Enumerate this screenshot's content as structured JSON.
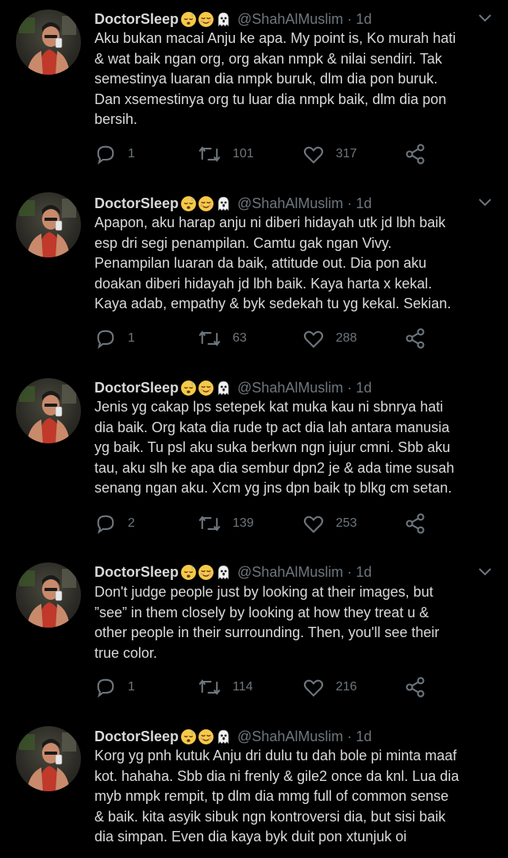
{
  "tweets": [
    {
      "name": "DoctorSleep",
      "handle": "@ShahAlMuslim",
      "time": "1d",
      "lines": [
        "Aku bukan macai Anju ke apa. My point is, Ko murah hati",
        "& wat baik ngan org, org akan nmpk & nilai sendiri. Tak",
        "semestinya luaran dia nmpk buruk, dlm dia pon buruk.",
        "Dan xsemestinya org tu luar dia nmpk baik, dlm dia pon",
        "bersih."
      ],
      "replies": "1",
      "retweets": "101",
      "likes": "317"
    },
    {
      "name": "DoctorSleep",
      "handle": "@ShahAlMuslim",
      "time": "1d",
      "lines": [
        "Apapon, aku harap anju ni diberi hidayah utk jd lbh baik",
        "esp dri segi penampilan. Camtu gak ngan Vivy.",
        "Penampilan luaran da baik, attitude out. Dia pon aku",
        "doakan diberi hidayah jd lbh baik. Kaya harta x kekal.",
        "Kaya adab, empathy & byk sedekah tu yg kekal. Sekian."
      ],
      "replies": "1",
      "retweets": "63",
      "likes": "288"
    },
    {
      "name": "DoctorSleep",
      "handle": "@ShahAlMuslim",
      "time": "1d",
      "lines": [
        "Jenis yg cakap lps setepek kat muka kau ni sbnrya hati",
        "dia baik. Org kata dia rude tp act dia lah antara manusia",
        "yg baik. Tu psl aku suka berkwn ngn jujur cmni. Sbb aku",
        "tau, aku slh ke apa dia sembur dpn2 je & ada time susah",
        "senang ngan aku. Xcm yg jns dpn baik tp blkg cm setan."
      ],
      "replies": "2",
      "retweets": "139",
      "likes": "253"
    },
    {
      "name": "DoctorSleep",
      "handle": "@ShahAlMuslim",
      "time": "1d",
      "lines": [
        "Don't judge people just by looking at their images, but",
        "”see” in them closely by looking at how they treat u &",
        "other people in their surrounding. Then, you'll see their",
        "true color."
      ],
      "replies": "1",
      "retweets": "114",
      "likes": "216"
    },
    {
      "name": "DoctorSleep",
      "handle": "@ShahAlMuslim",
      "time": "1d",
      "lines": [
        "Korg yg pnh kutuk Anju dri dulu tu dah bole pi minta maaf",
        "kot. hahaha. Sbb dia ni frenly & gile2 once da knl. Lua dia",
        "myb nmpk rempit, tp dlm dia mmg full of common sense",
        "& baik. kita asyik sibuk ngn kontroversi dia, but sisi baik",
        "dia simpan. Even dia kaya byk duit pon xtunjuk oi"
      ],
      "replies": "",
      "retweets": "",
      "likes": ""
    }
  ],
  "separator_dot": "·",
  "icons": {
    "name_emojis": [
      "sleeping-face-icon",
      "relieved-face-icon",
      "ghost-icon"
    ],
    "actions": [
      "reply-icon",
      "retweet-icon",
      "like-icon",
      "share-icon"
    ],
    "menu": "chevron-down-icon"
  },
  "colors": {
    "background": "#000000",
    "text": "#d9d9d9",
    "secondary": "#6e767d"
  }
}
